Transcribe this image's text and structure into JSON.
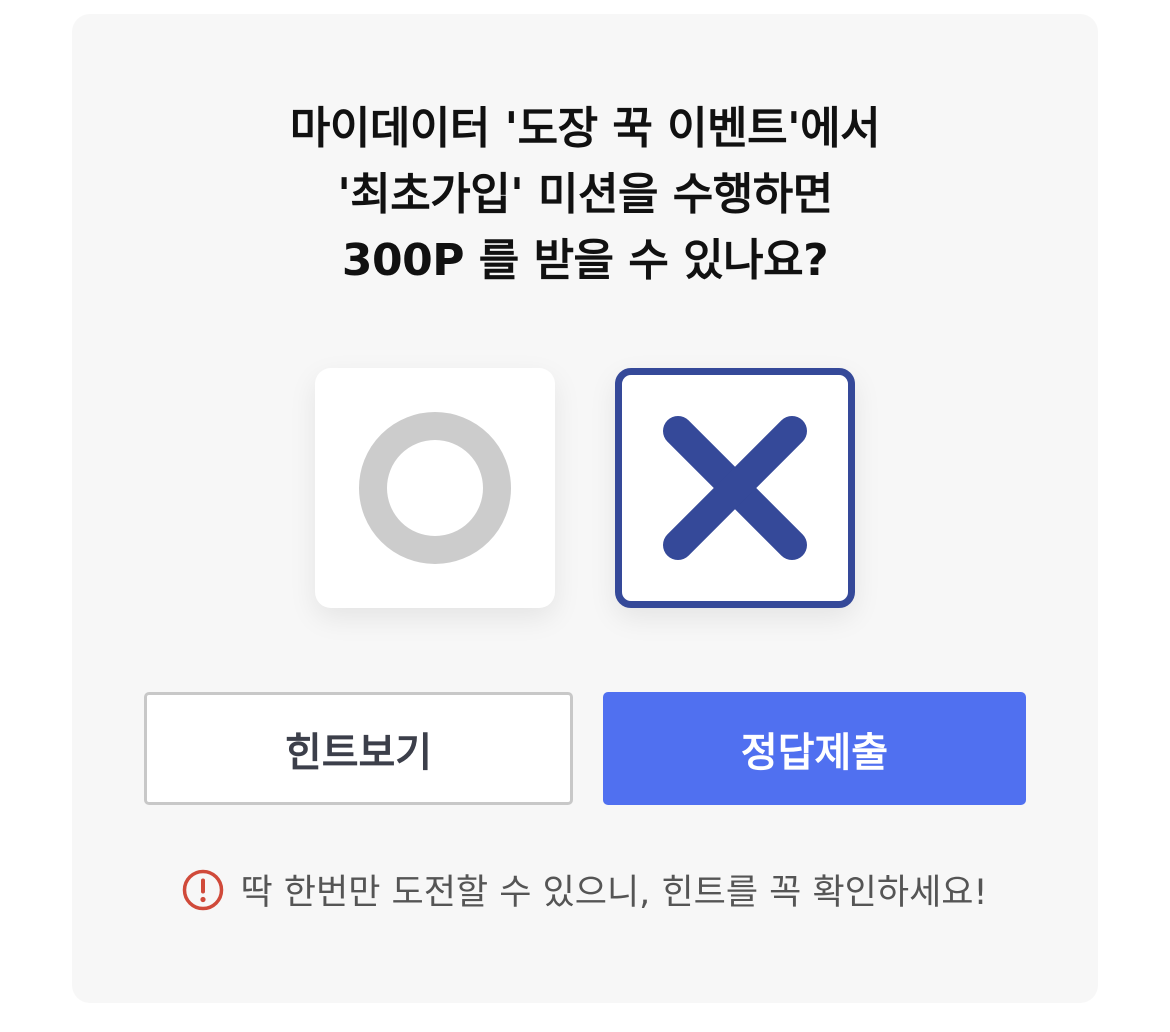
{
  "quiz": {
    "question_lines": [
      "마이데이터 '도장 꾹 이벤트'에서",
      "'최초가입' 미션을 수행하면",
      "300P 를 받을 수 있나요?"
    ],
    "options": {
      "o": {
        "icon": "circle-o-icon",
        "color": "#cccccc",
        "selected": false
      },
      "x": {
        "icon": "cross-x-icon",
        "color": "#354999",
        "selected": true
      }
    }
  },
  "actions": {
    "hint_label": "힌트보기",
    "submit_label": "정답제출"
  },
  "notice": {
    "icon": "exclamation-circle-icon",
    "icon_color": "#d04a3a",
    "text": "딱 한번만 도전할 수 있으니, 힌트를 꼭 확인하세요!"
  },
  "colors": {
    "accent": "#5070f0",
    "selected_border": "#354999",
    "card_bg": "#f7f7f7"
  }
}
